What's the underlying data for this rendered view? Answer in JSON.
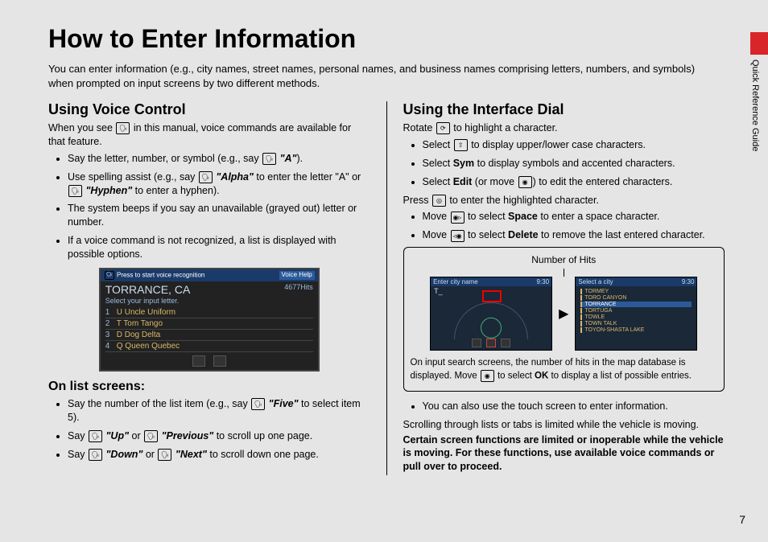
{
  "title": "How to Enter Information",
  "intro": "You can enter information (e.g., city names, street names, personal names, and business names comprising letters, numbers, and symbols) when prompted on input screens by two different methods.",
  "tab": "Quick Reference Guide",
  "page": "7",
  "left": {
    "h1": "Using Voice Control",
    "p1a": "When you see ",
    "p1b": " in this manual, voice commands are available for that feature.",
    "b1a": "Say the letter, number, or symbol (e.g., say ",
    "b1q": "\"A\"",
    "b1b": ").",
    "b2a": "Use spelling assist (e.g., say ",
    "b2q1": "\"Alpha\"",
    "b2b": " to enter the letter \"A\" or ",
    "b2q2": "\"Hyphen\"",
    "b2c": " to enter a hyphen).",
    "b3": "The system beeps if you say an unavailable (grayed out) letter or number.",
    "b4": "If a voice command is not recognized, a list is displayed with possible options.",
    "ss": {
      "hdr_l": "Press ",
      "hdr_r": "to start voice recognition",
      "help": "Voice Help",
      "title": "TORRANCE, CA",
      "hits": "4677Hits",
      "sub": "Select your input letter.",
      "r": [
        "U Uncle Uniform",
        "T Tom Tango",
        "D Dog Delta",
        "Q Queen Quebec"
      ]
    },
    "h2": "On list screens:",
    "l1a": "Say the number of the list item (e.g., say ",
    "l1q": "\"Five\"",
    "l1b": " to select item 5).",
    "l2a": "Say ",
    "l2q1": "\"Up\"",
    "l2b": " or ",
    "l2q2": "\"Previous\"",
    "l2c": " to scroll up one page.",
    "l3a": "Say ",
    "l3q1": "\"Down\"",
    "l3b": " or ",
    "l3q2": "\"Next\"",
    "l3c": " to scroll down one page."
  },
  "right": {
    "h1": "Using the Interface Dial",
    "p1a": "Rotate ",
    "p1b": " to highlight a character.",
    "b1a": "Select ",
    "b1b": " to display upper/lower case characters.",
    "b2a": "Select ",
    "b2s": "Sym",
    "b2b": " to display symbols and accented characters.",
    "b3a": "Select ",
    "b3s": "Edit",
    "b3b": " (or move ",
    "b3c": ") to edit the entered characters.",
    "p2a": "Press ",
    "p2b": " to enter the highlighted character.",
    "b4a": "Move ",
    "b4b": " to select ",
    "b4s": "Space",
    "b4c": " to enter a space character.",
    "b5a": "Move ",
    "b5b": " to select ",
    "b5s": "Delete",
    "b5c": " to remove the last entered character.",
    "diag": {
      "label": "Number of Hits",
      "m1": {
        "hdr": "Enter city name",
        "time": "9:30",
        "input": "T_"
      },
      "m2": {
        "hdr": "Select a city",
        "time": "9:30",
        "items": [
          "TORMEY",
          "TORO CANYON",
          "TORRANCE",
          "TORTUGA",
          "TOWLE",
          "TOWN TALK",
          "TOYON-SHASTA LAKE"
        ]
      },
      "note_a": "On input search screens, the number of hits in the map database is displayed. Move ",
      "note_b": " to select ",
      "note_ok": "OK",
      "note_c": " to display a list of possible entries."
    },
    "b6": "You can also use the touch screen to enter information.",
    "p3": "Scrolling through lists or tabs is limited while the vehicle is moving.",
    "p4": "Certain screen functions are limited or inoperable while the vehicle is moving. For these functions, use available voice commands or pull over to proceed."
  }
}
